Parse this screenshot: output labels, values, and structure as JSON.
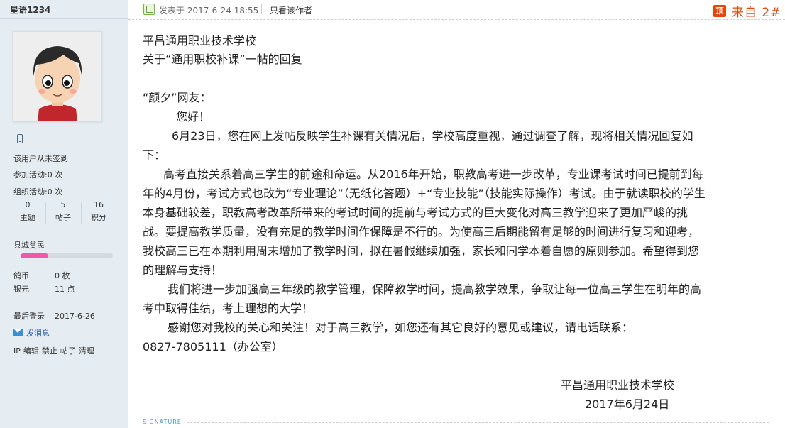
{
  "user": {
    "name": "星语1234",
    "sign_status": "该用户从未签到",
    "activity_join": "参加活动:0 次",
    "activity_org": "组织活动:0 次",
    "stats": [
      {
        "num": "0",
        "label": "主题"
      },
      {
        "num": "5",
        "label": "帖子"
      },
      {
        "num": "16",
        "label": "积分"
      }
    ],
    "level": "县城贫民",
    "level_progress": 0.3,
    "coins_label": "鸽币",
    "coins_value": "0 枚",
    "silver_label": "银元",
    "silver_value": "11 点",
    "last_login_label": "最后登录",
    "last_login_value": "2017-6-26",
    "message_link": "发消息",
    "actions": [
      "IP",
      "编辑",
      "禁止",
      "帖子",
      "清理"
    ]
  },
  "post": {
    "posted_at": "发表于 2017-6-24 18:55",
    "only_author": "只看该作者",
    "top_icon": "顶",
    "floor": "来自 2#",
    "lines": [
      "平昌通用职业技术学校",
      "关于“通用职校补课”一帖的回复",
      "“颜夕”网友：",
      "您好！",
      "6月23日，您在网上发帖反映学生补课有关情况后，学校高度重视，通过调查了解，现将相关情况回复如",
      "下：",
      "高考直接关系着高三学生的前途和命运。从2016年开始，职教高考进一步改革，专业课考试时间已提前到每",
      "年的4月份，考试方式也改为“专业理论”（无纸化答题）+“专业技能”（技能实际操作）考试。由于就读职校的学生",
      "本身基础较差，职教高考改革所带来的考试时间的提前与考试方式的巨大变化对高三教学迎来了更加严峻的挑",
      "战。要提高教学质量，没有充足的教学时间作保障是不行的。为使高三后期能留有足够的时间进行复习和迎考，",
      "我校高三已在本期利用周末增加了教学时间，拟在暑假继续加强，家长和同学本着自愿的原则参加。希望得到您",
      "的理解与支持！",
      "我们将进一步加强高三年级的教学管理，保障教学时间，提高教学效果，争取让每一位高三学生在明年的高",
      "考中取得佳绩，考上理想的大学！",
      "感谢您对我校的关心和关注！对于高三教学，如您还有其它良好的意见或建议，请电话联系：",
      "0827-7805111（办公室）",
      "平昌通用职业技术学校",
      "2017年6月24日"
    ],
    "signature_label": "SIGNATURE"
  },
  "colors": {
    "accent": "#e0480c",
    "sidebar_bg": "#e5edf2",
    "level_bar": "#ef5aa8",
    "link": "#2c5ea8"
  }
}
